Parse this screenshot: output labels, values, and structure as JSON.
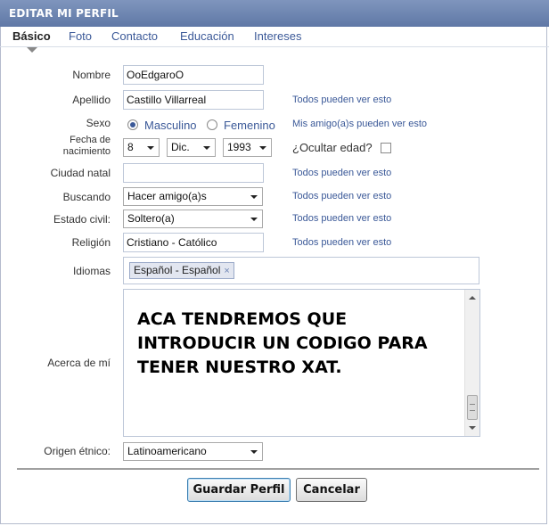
{
  "header": {
    "title": "EDITAR MI PERFIL"
  },
  "tabs": [
    {
      "label": "Básico",
      "active": true
    },
    {
      "label": "Foto"
    },
    {
      "label": "Contacto"
    },
    {
      "label": "Educación"
    },
    {
      "label": "Intereses"
    }
  ],
  "form": {
    "nombre": {
      "label": "Nombre",
      "value": "OoEdgaroO"
    },
    "apellido": {
      "label": "Apellido",
      "value": "Castillo Villarreal",
      "privacy": "Todos pueden ver esto"
    },
    "sexo": {
      "label": "Sexo",
      "options": [
        "Masculino",
        "Femenino"
      ],
      "selected": "Masculino",
      "privacy": "Mis amigo(a)s pueden ver esto"
    },
    "fecha": {
      "label_line1": "Fecha de",
      "label_line2": "nacimiento",
      "day": "8",
      "month": "Dic.",
      "year": "1993",
      "hide_age_label": "¿Ocultar edad?",
      "hide_age_checked": false
    },
    "ciudad": {
      "label": "Ciudad natal",
      "value": "",
      "privacy": "Todos pueden ver esto"
    },
    "buscando": {
      "label": "Buscando",
      "value": "Hacer amigo(a)s",
      "privacy": "Todos pueden ver esto"
    },
    "estado_civil": {
      "label": "Estado civil:",
      "value": "Soltero(a)",
      "privacy": "Todos pueden ver esto"
    },
    "religion": {
      "label": "Religión",
      "value": "Cristiano - Católico",
      "privacy": "Todos pueden ver esto"
    },
    "idiomas": {
      "label": "Idiomas",
      "token": "Español - Español",
      "remove": "×"
    },
    "acerca": {
      "label": "Acerca de mí",
      "text": "ACA TENDREMOS QUE INTRODUCIR UN CODIGO PARA TENER NUESTRO XAT."
    },
    "origen": {
      "label": "Origen étnico:",
      "value": "Latinoamericano"
    }
  },
  "buttons": {
    "save": "Guardar Perfil",
    "cancel": "Cancelar"
  },
  "colors": {
    "accent": "#3b5998",
    "header": "#6d84b4"
  }
}
